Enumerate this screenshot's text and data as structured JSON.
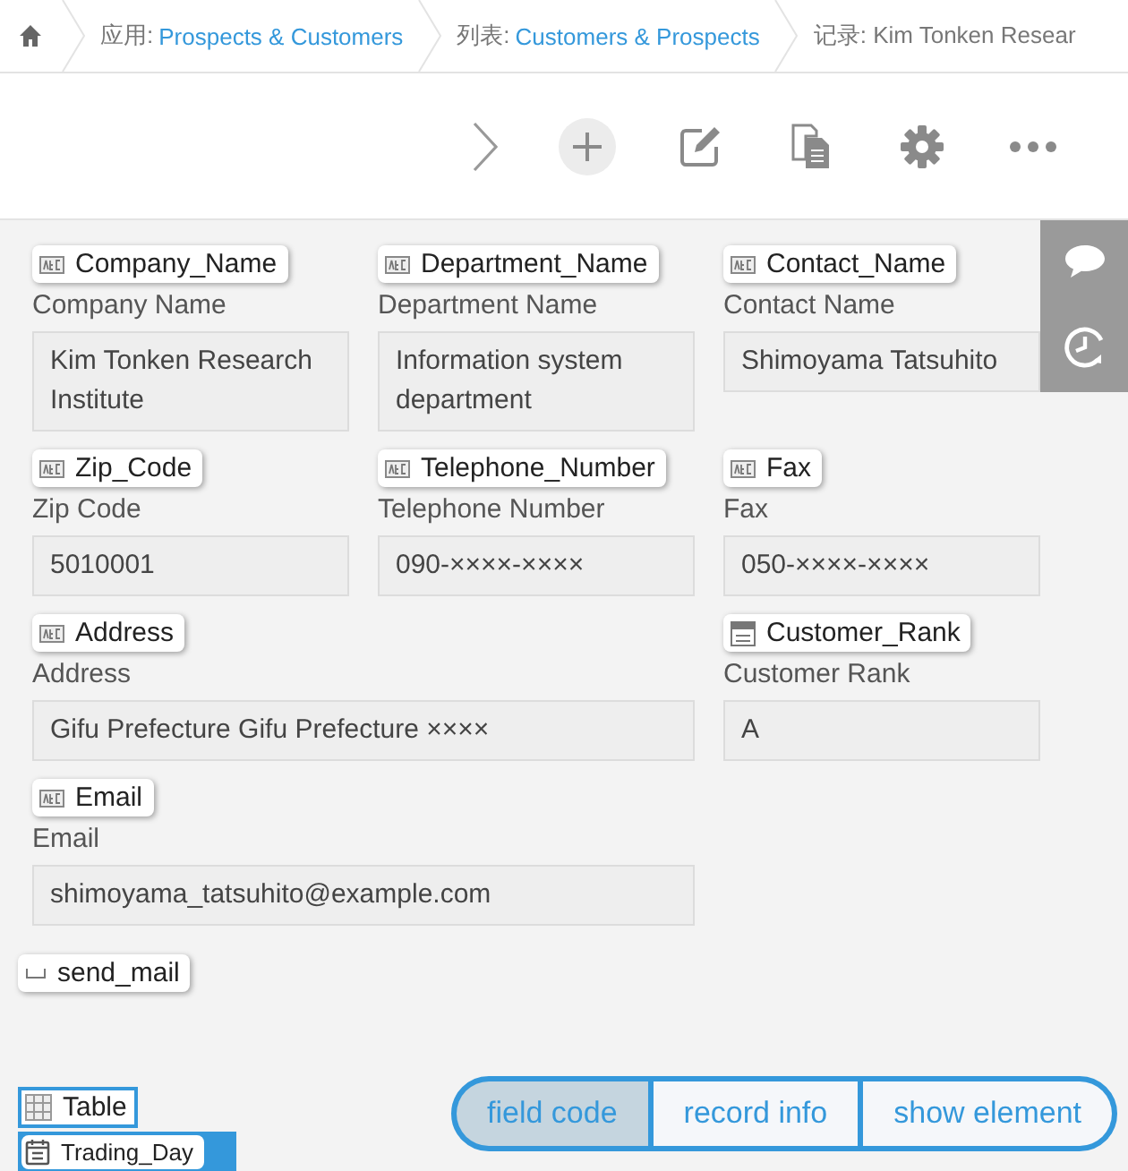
{
  "breadcrumb": [
    {
      "kind": "home"
    },
    {
      "kind": "link",
      "prefix": "应用:",
      "text": "Prospects & Customers"
    },
    {
      "kind": "link",
      "prefix": "列表:",
      "text": "Customers & Prospects"
    },
    {
      "kind": "current",
      "prefix": "记录:",
      "text": "Kim Tonken Resear"
    }
  ],
  "rows": [
    [
      {
        "code": "Company_Name",
        "kind": "text",
        "label": "Company Name",
        "value": "Kim Tonken Research Institute"
      },
      {
        "code": "Department_Name",
        "kind": "text",
        "label": "Department Name",
        "value": "Information system department"
      },
      {
        "code": "Contact_Name",
        "kind": "text",
        "label": "Contact Name",
        "value": "Shimoyama Tatsuhito"
      }
    ],
    [
      {
        "code": "Zip_Code",
        "kind": "text",
        "label": "Zip Code",
        "value": "5010001"
      },
      {
        "code": "Telephone_Number",
        "kind": "text",
        "label": "Telephone Number",
        "value": "090-××××-××××"
      },
      {
        "code": "Fax",
        "kind": "text",
        "label": "Fax",
        "value": "050-××××-××××"
      }
    ],
    [
      {
        "code": "Address",
        "kind": "text",
        "label": "Address",
        "value": "Gifu Prefecture Gifu Prefecture ××××"
      },
      {
        "code": "Customer_Rank",
        "kind": "dropdown",
        "label": "Customer Rank",
        "value": "A"
      }
    ],
    [
      {
        "code": "Email",
        "kind": "text",
        "label": "Email",
        "value": "shimoyama_tatsuhito@example.com"
      }
    ]
  ],
  "space": {
    "code": "send_mail",
    "kind": "space"
  },
  "table": {
    "code": "Table",
    "kind": "table",
    "children": [
      {
        "code": "Trading_Day",
        "kind": "date"
      }
    ]
  },
  "toggles": [
    {
      "label": "field code",
      "selected": true
    },
    {
      "label": "record info",
      "selected": false
    },
    {
      "label": "show element",
      "selected": false
    }
  ]
}
